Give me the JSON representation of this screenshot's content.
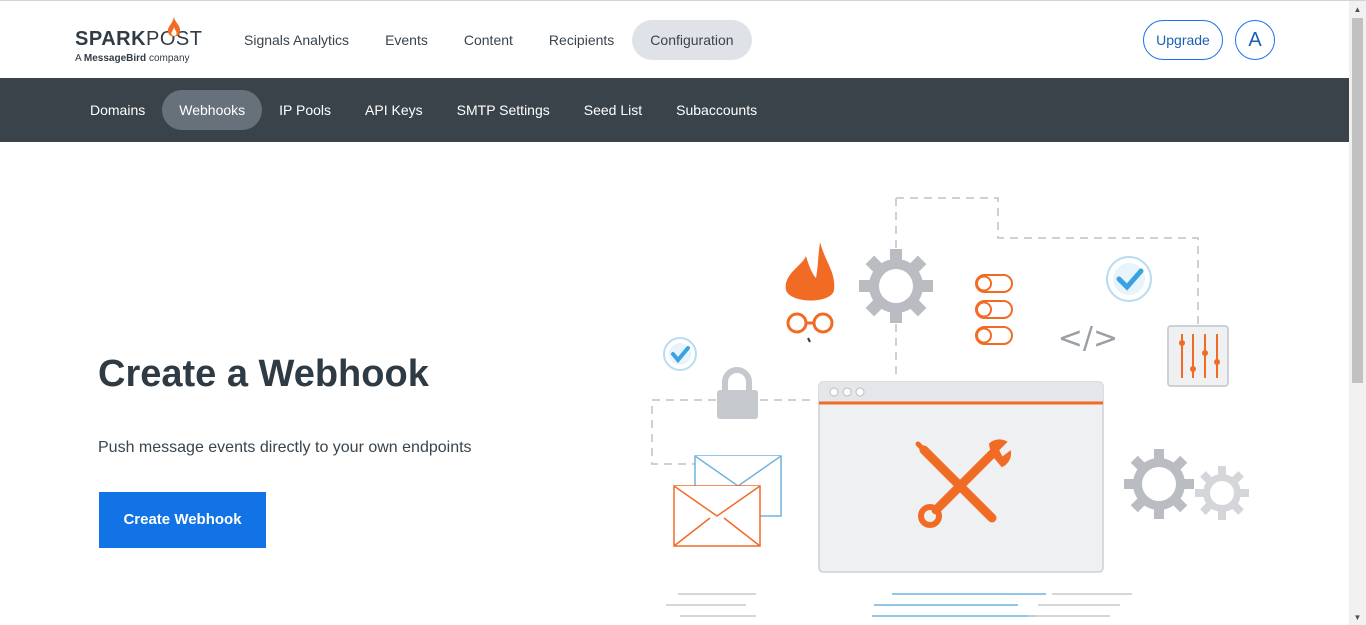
{
  "brand": {
    "name_bold": "SPARK",
    "name_light": "POST",
    "tagline_prefix": "A",
    "tagline_bold": "MessageBird",
    "tagline_suffix": "company",
    "colors": {
      "orange": "#f26b24",
      "dark": "#303b44",
      "blue": "#1273e6"
    }
  },
  "main_nav": {
    "items": [
      {
        "label": "Signals Analytics",
        "active": false
      },
      {
        "label": "Events",
        "active": false
      },
      {
        "label": "Content",
        "active": false
      },
      {
        "label": "Recipients",
        "active": false
      },
      {
        "label": "Configuration",
        "active": true
      }
    ],
    "upgrade_label": "Upgrade",
    "avatar_initial": "A"
  },
  "sub_nav": {
    "items": [
      {
        "label": "Domains",
        "active": false
      },
      {
        "label": "Webhooks",
        "active": true
      },
      {
        "label": "IP Pools",
        "active": false
      },
      {
        "label": "API Keys",
        "active": false
      },
      {
        "label": "SMTP Settings",
        "active": false
      },
      {
        "label": "Seed List",
        "active": false
      },
      {
        "label": "Subaccounts",
        "active": false
      }
    ]
  },
  "hero": {
    "title": "Create a Webhook",
    "description": "Push message events directly to your own endpoints",
    "button_label": "Create Webhook"
  },
  "illustration": {
    "code_glyph": "</>"
  }
}
